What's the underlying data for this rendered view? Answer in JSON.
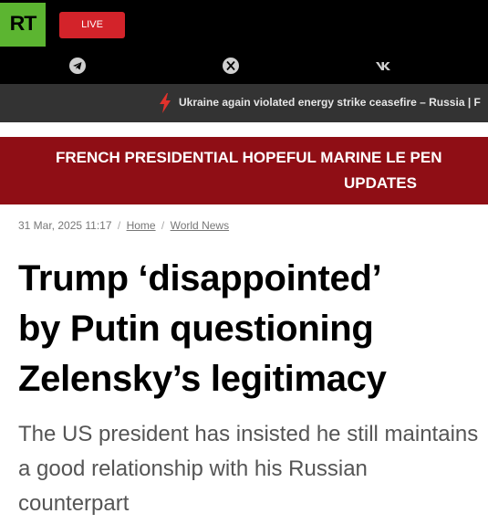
{
  "header": {
    "logo_text": "RT",
    "live_label": "LIVE",
    "social_icons": [
      "telegram-icon",
      "x-icon",
      "vk-icon"
    ]
  },
  "ticker": {
    "text": "Ukraine again violated energy strike ceasefire – Russia | F"
  },
  "banner": {
    "line1": "FRENCH PRESIDENTIAL HOPEFUL MARINE LE PEN",
    "line2": "UPDATES"
  },
  "article": {
    "datetime": "31 Mar, 2025 11:17",
    "breadcrumb": [
      "Home",
      "World News"
    ],
    "title_lines": [
      "Trump ‘disappointed’",
      "by Putin questioning",
      "Zelensky’s legitimacy"
    ],
    "subtitle": "The US president has insisted he still maintains a good relationship with his Russian counterpart"
  },
  "colors": {
    "brand_green": "#5cb531",
    "live_red": "#d3232a",
    "banner_red": "#8f0e15",
    "ticker_bg": "#333333",
    "bolt": "#e0322c"
  }
}
